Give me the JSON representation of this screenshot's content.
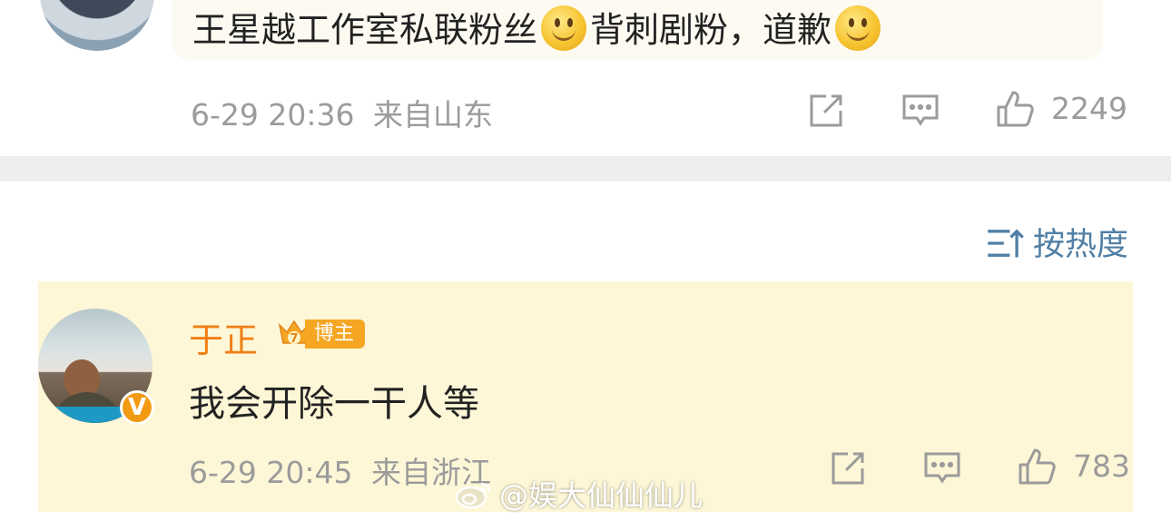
{
  "top_comment": {
    "text_part1": "王星越工作室私联粉丝",
    "text_part2": "背刺剧粉，道歉",
    "emoji": "smile-emoji",
    "timestamp": "6-29 20:36",
    "location": "来自山东",
    "likes": "2249"
  },
  "sort": {
    "label": "按热度",
    "icon": "sort-icon"
  },
  "highlight_comment": {
    "username": "于正",
    "badge_label": "博主",
    "crown_level": "7",
    "verified_badge": "V",
    "text": "我会开除一干人等",
    "timestamp": "6-29 20:45",
    "location": "来自浙江",
    "likes": "783"
  },
  "watermark": {
    "text": "@娱大仙仙仙儿"
  },
  "colors": {
    "username": "#f07e14",
    "link_blue": "#4f7fa6",
    "meta_gray": "#9b9b9b",
    "highlight_bg": "#fdf7d7",
    "badge_orange": "#f5a623"
  }
}
